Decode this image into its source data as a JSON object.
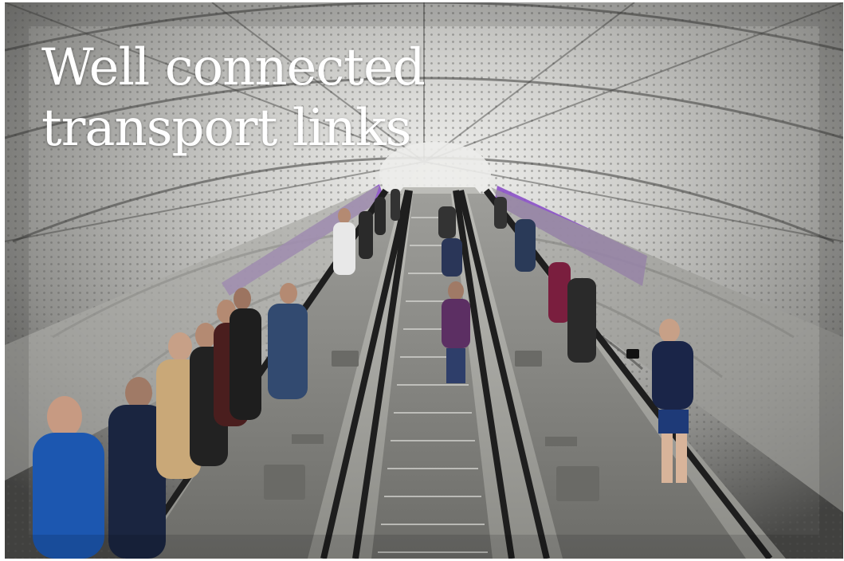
{
  "headline": {
    "line1": "Well connected",
    "line2": "transport links"
  },
  "photo": {
    "subject": "escalator-tunnel-photo",
    "accent_color": "#8a4fc6",
    "tunnel_color": "#c9c9c7"
  }
}
